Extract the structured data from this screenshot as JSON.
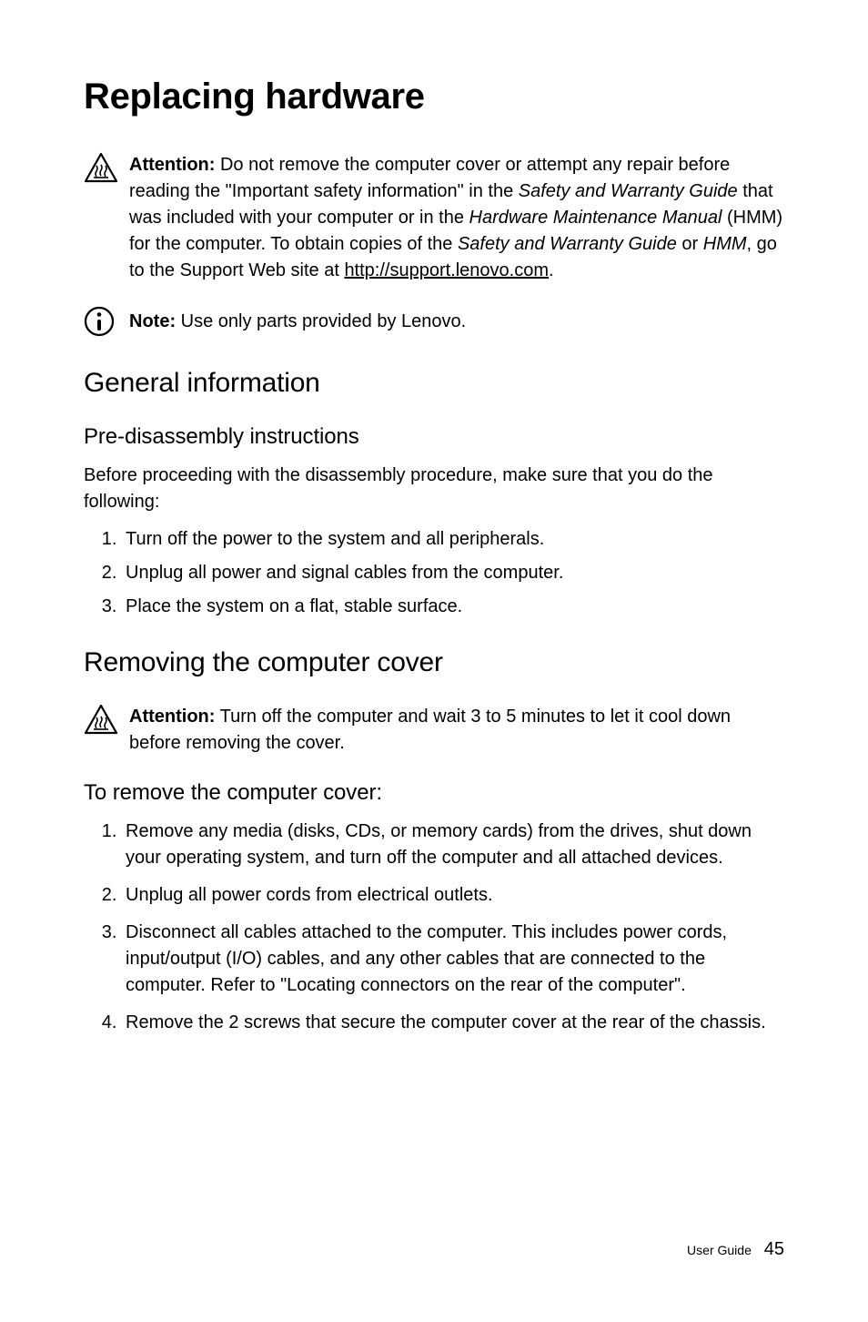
{
  "title": "Replacing hardware",
  "attention1": {
    "lead": "Attention:",
    "p1a": " Do not remove the computer cover or attempt any repair before reading the \"Important safety information\" in the ",
    "i1": "Safety and Warranty Guide",
    "p1b": " that was included with your computer or in the ",
    "i2": "Hardware Maintenance Manual",
    "p1c": " (HMM) for the computer. To obtain copies of the ",
    "i3": "Safety and Warranty Guide",
    "p1d": " or ",
    "i4": "HMM",
    "p1e": ", go to the Support Web site at ",
    "link": "http://support.lenovo.com",
    "p1f": "."
  },
  "note": {
    "lead": "Note:",
    "text": " Use only parts provided by Lenovo."
  },
  "section_general": "General information",
  "sub_pre": "Pre-disassembly instructions",
  "pre_para": "Before proceeding with the disassembly procedure, make sure that you do the following:",
  "pre_list": {
    "i1": "Turn off the power to the system and all peripherals.",
    "i2": "Unplug all power and signal cables from the computer.",
    "i3": "Place the system on a flat, stable surface."
  },
  "section_remove": "Removing the computer cover",
  "attention2": {
    "lead": "Attention:",
    "text": " Turn off the computer and wait 3 to 5 minutes to let it cool down before removing the cover."
  },
  "sub_to_remove": "To remove the computer cover:",
  "remove_list": {
    "i1": "Remove any media (disks, CDs, or memory cards) from the drives, shut down your operating system, and turn off the computer and all attached devices.",
    "i2": "Unplug all power cords from electrical outlets.",
    "i3": "Disconnect all cables attached to the computer. This includes power cords, input/output (I/O) cables, and any other cables that are connected to the computer. Refer to \"Locating connectors on the rear of the computer\".",
    "i4": "Remove the 2 screws that secure the computer cover at the rear of the chassis."
  },
  "footer_label": "User Guide",
  "footer_page": "45"
}
